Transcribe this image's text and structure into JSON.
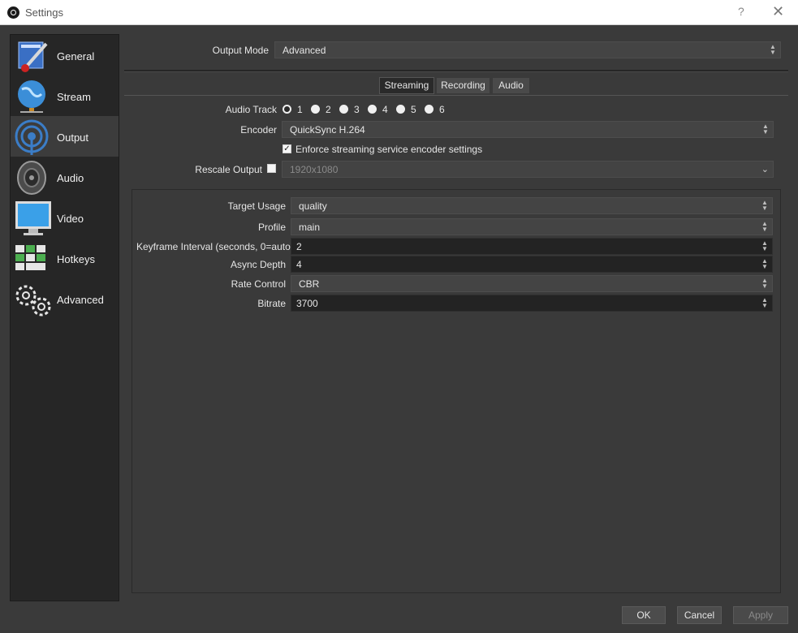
{
  "window": {
    "title": "Settings",
    "help": "?",
    "close": "✕"
  },
  "sidebar": {
    "items": [
      {
        "label": "General",
        "icon": "general-icon"
      },
      {
        "label": "Stream",
        "icon": "stream-icon"
      },
      {
        "label": "Output",
        "icon": "output-icon",
        "active": true
      },
      {
        "label": "Audio",
        "icon": "audio-icon"
      },
      {
        "label": "Video",
        "icon": "video-icon"
      },
      {
        "label": "Hotkeys",
        "icon": "hotkeys-icon"
      },
      {
        "label": "Advanced",
        "icon": "advanced-icon"
      }
    ]
  },
  "output_mode": {
    "label": "Output Mode",
    "value": "Advanced"
  },
  "tabs": [
    {
      "label": "Streaming",
      "active": true
    },
    {
      "label": "Recording"
    },
    {
      "label": "Audio"
    }
  ],
  "streaming": {
    "audio_track": {
      "label": "Audio Track",
      "options": [
        "1",
        "2",
        "3",
        "4",
        "5",
        "6"
      ],
      "selected": "1"
    },
    "encoder": {
      "label": "Encoder",
      "value": "QuickSync H.264"
    },
    "enforce": {
      "label": "Enforce streaming service encoder settings",
      "checked": true
    },
    "rescale": {
      "label": "Rescale Output",
      "checked": false,
      "value": "1920x1080"
    }
  },
  "encoder_settings": {
    "target_usage": {
      "label": "Target Usage",
      "value": "quality"
    },
    "profile": {
      "label": "Profile",
      "value": "main"
    },
    "keyframe": {
      "label": "Keyframe Interval (seconds, 0=auto)",
      "value": "2"
    },
    "async_depth": {
      "label": "Async Depth",
      "value": "4"
    },
    "rate_control": {
      "label": "Rate Control",
      "value": "CBR"
    },
    "bitrate": {
      "label": "Bitrate",
      "value": "3700"
    }
  },
  "buttons": {
    "ok": "OK",
    "cancel": "Cancel",
    "apply": "Apply"
  }
}
